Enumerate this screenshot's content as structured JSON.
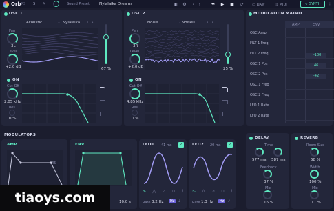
{
  "topbar": {
    "logo": "Orb",
    "logo_sub": "PS",
    "btn_s": "S",
    "btn_m": "M",
    "preset_label": "Sound Preset",
    "preset_name": "Nylalaika Dreams",
    "tab_daw": "DAW",
    "tab_midi": "MIDI",
    "tab_synth": "SYNTH"
  },
  "osc1": {
    "title": "OSC 1",
    "wave": "Acoustic",
    "preset": "Nylalaika",
    "pan_label": "Pan",
    "pan_value": "3L",
    "level_label": "Level",
    "level_value": "+2.0 dB",
    "slider_value": "67 %",
    "slider_fraction": 0.67
  },
  "osc2": {
    "title": "OSC 2",
    "wave": "Noise",
    "preset": "Noise01",
    "pan_label": "Pan",
    "pan_value": "3R",
    "level_label": "Level",
    "level_value": "+2.0 dB",
    "slider_value": "25 %",
    "slider_fraction": 0.25
  },
  "filter1": {
    "on_label": "ON",
    "cutoff_label": "Cut-Off",
    "cutoff_value": "2.05 kHz",
    "res_label": "Res",
    "res_value": "0 %"
  },
  "filter2": {
    "on_label": "ON",
    "cutoff_label": "Cut-Off",
    "cutoff_value": "4.85 kHz",
    "res_label": "Res",
    "res_value": "0 %"
  },
  "matrix": {
    "title": "MODULATION MATRIX",
    "col_amp": "AMP",
    "col_env": "ENV",
    "rows": [
      "OSC Amp",
      "FILT 1 Freq",
      "FILT 2 Freq",
      "OSC 1 Pos",
      "OSC 2 Pos",
      "OSC 1 Freq",
      "OSC 2 Freq",
      "LFO 1 Rate",
      "LFO 2 Rate"
    ],
    "cell_filt2": "-100",
    "cell_osc1": "46",
    "cell_osc2": "-42"
  },
  "modulators": {
    "title": "MODULATORS",
    "amp_label": "AMP",
    "env_label": "ENV",
    "amp_point": "45",
    "env_release": "10.0 s",
    "lfo1_label": "LFO1",
    "lfo1_time": "41 ms",
    "lfo1_rate": "Rate",
    "lfo1_rate_value": "3.2 Hz",
    "lfo1_hz": "Hz",
    "lfo2_label": "LFO2",
    "lfo2_time": "20 ms",
    "lfo2_rate": "Rate",
    "lfo2_rate_value": "1.3 Hz",
    "lfo2_hz": "Hz"
  },
  "delay": {
    "title": "DELAY",
    "time_label": "Time",
    "time_l": "577 ms",
    "time_r": "587 ms",
    "feedback_label": "Feedback",
    "feedback_value": "37 %",
    "mix_label": "Mix",
    "mix_value": "16 %"
  },
  "reverb": {
    "title": "REVERB",
    "size_label": "Room Size",
    "size_value": "58 %",
    "width_label": "Width",
    "width_value": "100 %",
    "mix_label": "Mix",
    "mix_value": "11 %"
  },
  "watermark": "tiaoys.com",
  "colors": {
    "accent": "#5ee8c0",
    "wave": "#8f8ae6",
    "bg": "#1b1d2e",
    "panel": "#23263a"
  }
}
